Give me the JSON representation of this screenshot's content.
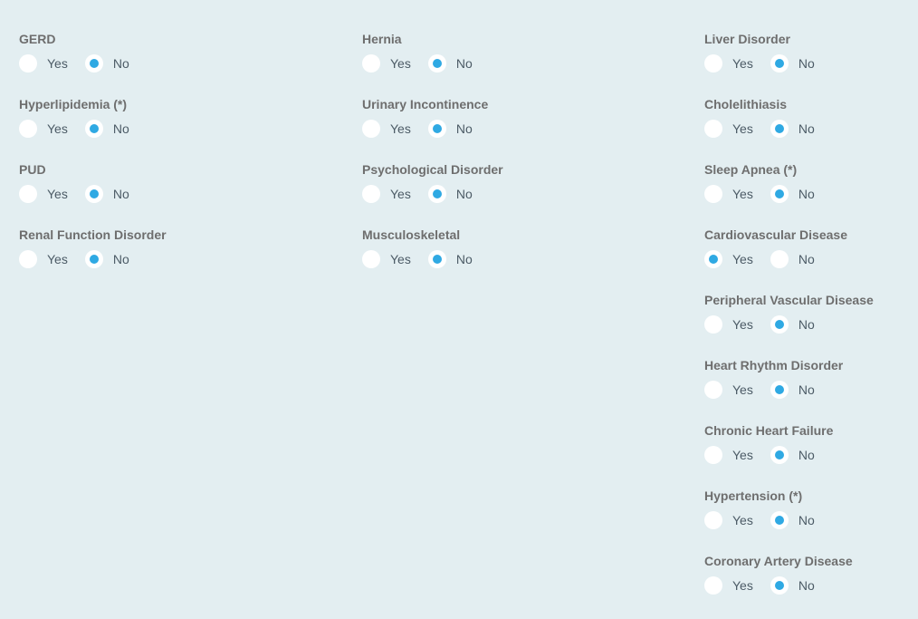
{
  "form": {
    "options": {
      "yes": "Yes",
      "no": "No"
    },
    "columns": [
      {
        "questions": [
          {
            "label": "GERD",
            "selected": "no"
          },
          {
            "label": "Hyperlipidemia (*)",
            "selected": "no"
          },
          {
            "label": "PUD",
            "selected": "no"
          },
          {
            "label": "Renal Function Disorder",
            "selected": "no"
          }
        ]
      },
      {
        "questions": [
          {
            "label": "Hernia",
            "selected": "no"
          },
          {
            "label": "Urinary Incontinence",
            "selected": "no"
          },
          {
            "label": "Psychological Disorder",
            "selected": "no"
          },
          {
            "label": "Musculoskeletal",
            "selected": "no"
          }
        ]
      },
      {
        "questions": [
          {
            "label": "Liver Disorder",
            "selected": "no"
          },
          {
            "label": "Cholelithiasis",
            "selected": "no"
          },
          {
            "label": "Sleep Apnea (*)",
            "selected": "no"
          },
          {
            "label": "Cardiovascular Disease",
            "selected": "yes"
          },
          {
            "label": "Peripheral Vascular Disease",
            "selected": "no"
          },
          {
            "label": "Heart Rhythm Disorder",
            "selected": "no"
          },
          {
            "label": "Chronic Heart Failure",
            "selected": "no"
          },
          {
            "label": "Hypertension (*)",
            "selected": "no"
          },
          {
            "label": "Coronary Artery Disease",
            "selected": "no"
          }
        ]
      }
    ]
  },
  "colors": {
    "background": "#e3eef1",
    "radio_accent": "#2fa9e3",
    "label_text": "#6e6e6e",
    "option_text": "#4c5b66"
  }
}
